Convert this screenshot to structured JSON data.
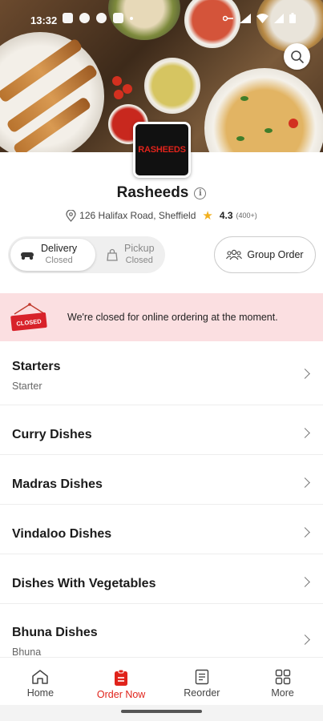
{
  "status_bar": {
    "time": "13:32"
  },
  "restaurant": {
    "logo_text": "RASHEEDS",
    "name": "Rasheeds",
    "address": "126 Halifax Road, Sheffield",
    "rating": "4.3",
    "reviews": "(400+)"
  },
  "order_mode": {
    "delivery_label": "Delivery",
    "delivery_status": "Closed",
    "pickup_label": "Pickup",
    "pickup_status": "Closed",
    "selected": "Delivery"
  },
  "group_order": {
    "label": "Group Order"
  },
  "closed_banner": {
    "sign_text": "CLOSED",
    "message": "We're closed for online ordering at the moment."
  },
  "categories": [
    {
      "title": "Starters",
      "subtitle": "Starter"
    },
    {
      "title": "Curry Dishes",
      "subtitle": ""
    },
    {
      "title": "Madras Dishes",
      "subtitle": ""
    },
    {
      "title": "Vindaloo Dishes",
      "subtitle": ""
    },
    {
      "title": "Dishes With Vegetables",
      "subtitle": ""
    },
    {
      "title": "Bhuna Dishes",
      "subtitle": "Bhuna"
    }
  ],
  "bottom_nav": {
    "items": [
      {
        "label": "Home",
        "icon": "home-icon"
      },
      {
        "label": "Order Now",
        "icon": "order-icon"
      },
      {
        "label": "Reorder",
        "icon": "receipt-icon"
      },
      {
        "label": "More",
        "icon": "grid-icon"
      }
    ],
    "active": "Order Now"
  },
  "colors": {
    "brand_red": "#e0231b",
    "banner_bg": "#fbdfe1",
    "star": "#f2b01e"
  }
}
